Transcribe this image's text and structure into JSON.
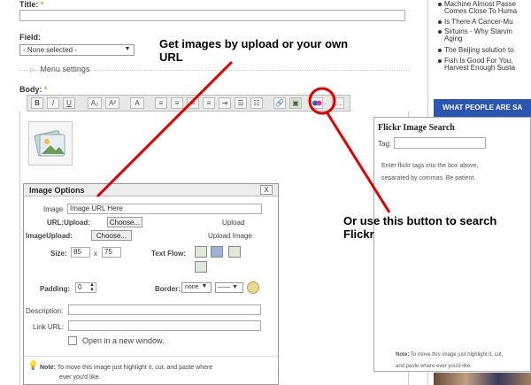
{
  "form": {
    "title_label": "Title:",
    "required_mark": "*",
    "field_label": "Field:",
    "field_value": "- None selected -",
    "menu_settings": "Menu settings",
    "body_label": "Body:"
  },
  "toolbar": {
    "buttons": [
      "B",
      "I",
      "U",
      "A₂",
      "A²",
      "A"
    ]
  },
  "news": {
    "items": [
      "Machine Almost Passe Comes Close To Huma",
      "Is There A Cancer-Mu",
      "Sirtuins - Why Starvin Aging",
      "The Beijing solution to",
      "Fish Is Good For You, Harvest Enough Susta"
    ],
    "banner": "WHAT PEOPLE ARE SA"
  },
  "annotations": {
    "top": "Get images by upload or your own URL",
    "bottom": "Or use this button to search Flickr"
  },
  "image_options": {
    "title": "Image Options",
    "close": "X",
    "image_label": "Image",
    "image_value": "Image URL Here",
    "url_upload_label": "URL:Upload:",
    "choose": "Choose...",
    "upload_label": "Upload",
    "image_upload_label": "ImageUpload:",
    "upload_image_label": "Upload Image",
    "size_label": "Size:",
    "size_w": "85",
    "size_x": "x",
    "size_h": "75",
    "text_flow_label": "Text Flow:",
    "padding_label": "Padding:",
    "padding_value": "0",
    "border_label": "Border:",
    "border_value": "none",
    "description_label": "Description:",
    "link_url_label": "Link URL:",
    "open_new_window": "Open in a new window.",
    "note_bold": "Note:",
    "note_line1": "To move this image just highlight it, cut, and paste where",
    "note_line2": "ever you'd like."
  },
  "flickr": {
    "title": "Flickr Image Search",
    "tag_label": "Tag:",
    "help_line1": "Enter flickr tags into the box above,",
    "help_line2": "separated by commas. Be patient.",
    "note_bold": "Note:",
    "note_line1": "To move this image just highlight it, cut,",
    "note_line2": "and paste where ever you'd like."
  },
  "colors": {
    "annotation_red": "#e00000",
    "banner_blue": "#2a55b0"
  }
}
